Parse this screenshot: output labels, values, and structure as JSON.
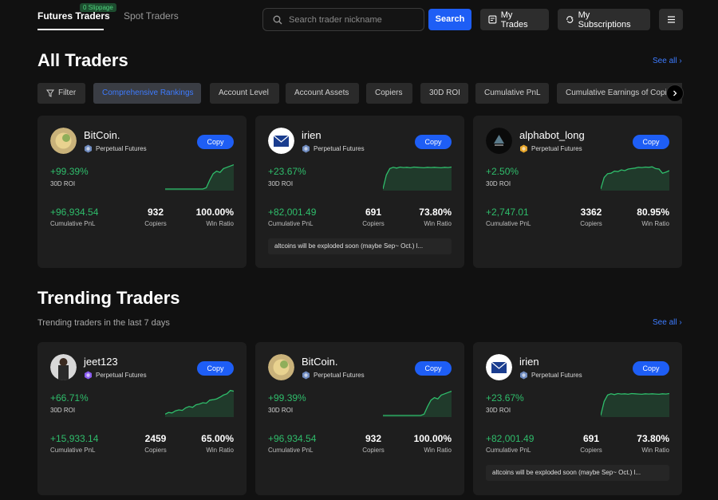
{
  "header": {
    "tabs": [
      {
        "label": "Futures Traders",
        "active": true
      },
      {
        "label": "Spot Traders",
        "active": false
      }
    ],
    "slippage_badge": "0 Slippage",
    "search_placeholder": "Search trader nickname",
    "search_button": "Search",
    "my_trades": "My Trades",
    "my_subscriptions": "My Subscriptions"
  },
  "all_traders": {
    "title": "All Traders",
    "see_all": "See all",
    "filters": [
      "Filter",
      "Comprehensive Rankings",
      "Account Level",
      "Account Assets",
      "Copiers",
      "30D ROI",
      "Cumulative PnL",
      "Cumulative Earnings of Copiers"
    ],
    "active_filter": "Comprehensive Rankings",
    "cards": [
      {
        "name": "BitCoin.",
        "product": "Perpetual Futures",
        "copy": "Copy",
        "roi": "+99.39%",
        "roi_label": "30D ROI",
        "pnl": "+96,934.54",
        "pnl_label": "Cumulative PnL",
        "copiers": "932",
        "copiers_label": "Copiers",
        "win": "100.00%",
        "win_label": "Win Ratio",
        "quote": "",
        "roi_series": [
          0,
          0,
          0,
          0,
          0,
          0,
          0,
          0,
          0,
          0,
          0,
          0,
          0.05,
          0.35,
          0.6,
          0.7,
          0.65,
          0.8,
          0.85,
          0.9,
          0.95
        ]
      },
      {
        "name": "irien",
        "product": "Perpetual Futures",
        "copy": "Copy",
        "roi": "+23.67%",
        "roi_label": "30D ROI",
        "pnl": "+82,001.49",
        "pnl_label": "Cumulative PnL",
        "copiers": "691",
        "copiers_label": "Copiers",
        "win": "73.80%",
        "win_label": "Win Ratio",
        "quote": "altcoins will be exploded soon (maybe Sep~ Oct.) l...",
        "roi_series": [
          0,
          0.55,
          0.8,
          0.85,
          0.82,
          0.86,
          0.84,
          0.85,
          0.83,
          0.86,
          0.85,
          0.84,
          0.83,
          0.85,
          0.84,
          0.85,
          0.84,
          0.83,
          0.85,
          0.84,
          0.86
        ]
      },
      {
        "name": "alphabot_long",
        "product": "Perpetual Futures",
        "copy": "Copy",
        "roi": "+2.50%",
        "roi_label": "30D ROI",
        "pnl": "+2,747.01",
        "pnl_label": "Cumulative PnL",
        "copiers": "3362",
        "copiers_label": "Copiers",
        "win": "80.95%",
        "win_label": "Win Ratio",
        "quote": "",
        "roi_series": [
          0,
          0.45,
          0.6,
          0.62,
          0.7,
          0.68,
          0.75,
          0.72,
          0.78,
          0.8,
          0.82,
          0.85,
          0.84,
          0.86,
          0.85,
          0.87,
          0.8,
          0.78,
          0.62,
          0.66,
          0.72
        ]
      }
    ]
  },
  "trending_traders": {
    "title": "Trending Traders",
    "subtitle": "Trending traders in the last 7 days",
    "see_all": "See all",
    "cards": [
      {
        "name": "jeet123",
        "product": "Perpetual Futures",
        "copy": "Copy",
        "roi": "+66.71%",
        "roi_label": "30D ROI",
        "pnl": "+15,933.14",
        "pnl_label": "Cumulative PnL",
        "copiers": "2459",
        "copiers_label": "Copiers",
        "win": "65.00%",
        "win_label": "Win Ratio",
        "quote": "",
        "roi_series": [
          0.05,
          0.12,
          0.1,
          0.18,
          0.22,
          0.2,
          0.3,
          0.35,
          0.32,
          0.42,
          0.45,
          0.5,
          0.48,
          0.6,
          0.62,
          0.65,
          0.72,
          0.8,
          0.85,
          0.98,
          0.95
        ]
      },
      {
        "name": "BitCoin.",
        "product": "Perpetual Futures",
        "copy": "Copy",
        "roi": "+99.39%",
        "roi_label": "30D ROI",
        "pnl": "+96,934.54",
        "pnl_label": "Cumulative PnL",
        "copiers": "932",
        "copiers_label": "Copiers",
        "win": "100.00%",
        "win_label": "Win Ratio",
        "quote": "",
        "roi_series": [
          0,
          0,
          0,
          0,
          0,
          0,
          0,
          0,
          0,
          0,
          0,
          0,
          0.05,
          0.35,
          0.6,
          0.7,
          0.65,
          0.8,
          0.85,
          0.9,
          0.95
        ]
      },
      {
        "name": "irien",
        "product": "Perpetual Futures",
        "copy": "Copy",
        "roi": "+23.67%",
        "roi_label": "30D ROI",
        "pnl": "+82,001.49",
        "pnl_label": "Cumulative PnL",
        "copiers": "691",
        "copiers_label": "Copiers",
        "win": "73.80%",
        "win_label": "Win Ratio",
        "quote": "altcoins will be exploded soon (maybe Sep~ Oct.) l...",
        "roi_series": [
          0,
          0.55,
          0.8,
          0.85,
          0.82,
          0.86,
          0.84,
          0.85,
          0.83,
          0.86,
          0.85,
          0.84,
          0.83,
          0.85,
          0.84,
          0.85,
          0.84,
          0.83,
          0.85,
          0.84,
          0.86
        ]
      }
    ]
  },
  "colors": {
    "accent": "#1e5ef5",
    "positive": "#2fbd6b",
    "link": "#3d7bff"
  }
}
